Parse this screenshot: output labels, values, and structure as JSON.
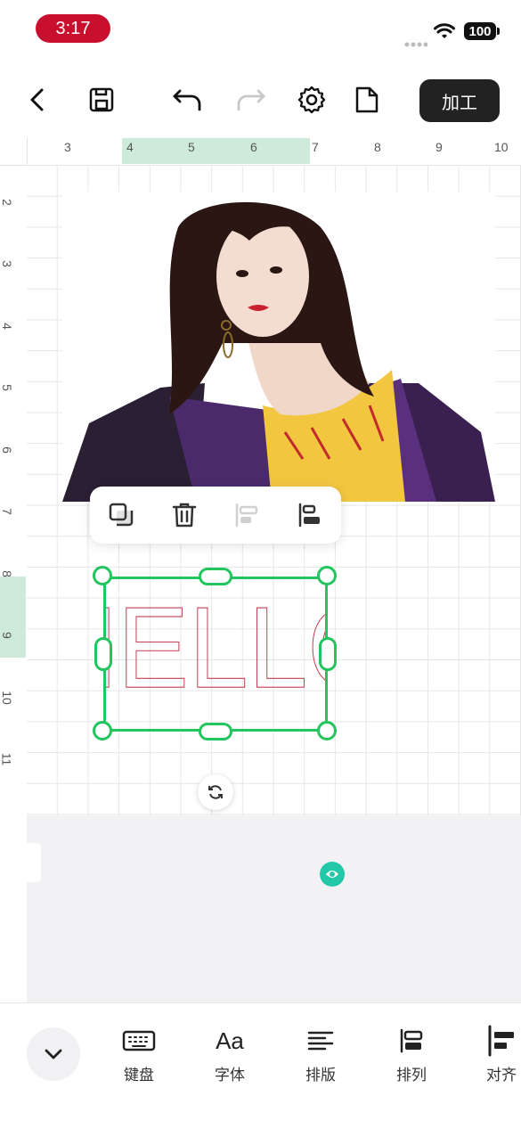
{
  "status_bar": {
    "time": "3:17",
    "battery": "100"
  },
  "toolbar": {
    "process_label": "加工"
  },
  "ruler": {
    "top_labels": [
      "3",
      "4",
      "5",
      "6",
      "7",
      "8",
      "9",
      "10"
    ],
    "left_labels": [
      "2",
      "3",
      "4",
      "5",
      "6",
      "7",
      "8",
      "9",
      "10",
      "11"
    ],
    "highlight_color": "#cdebd8"
  },
  "canvas": {
    "text_object": "HELLO",
    "selection_color": "#22c55e",
    "text_stroke_color": "#c04050"
  },
  "bottom_bar": {
    "items": [
      {
        "label": "键盘",
        "icon": "keyboard-icon"
      },
      {
        "label": "字体",
        "icon": "font-icon"
      },
      {
        "label": "排版",
        "icon": "layout-icon"
      },
      {
        "label": "排列",
        "icon": "arrange-icon"
      },
      {
        "label": "对齐",
        "icon": "align-icon"
      }
    ],
    "font_icon_text": "Aa"
  }
}
